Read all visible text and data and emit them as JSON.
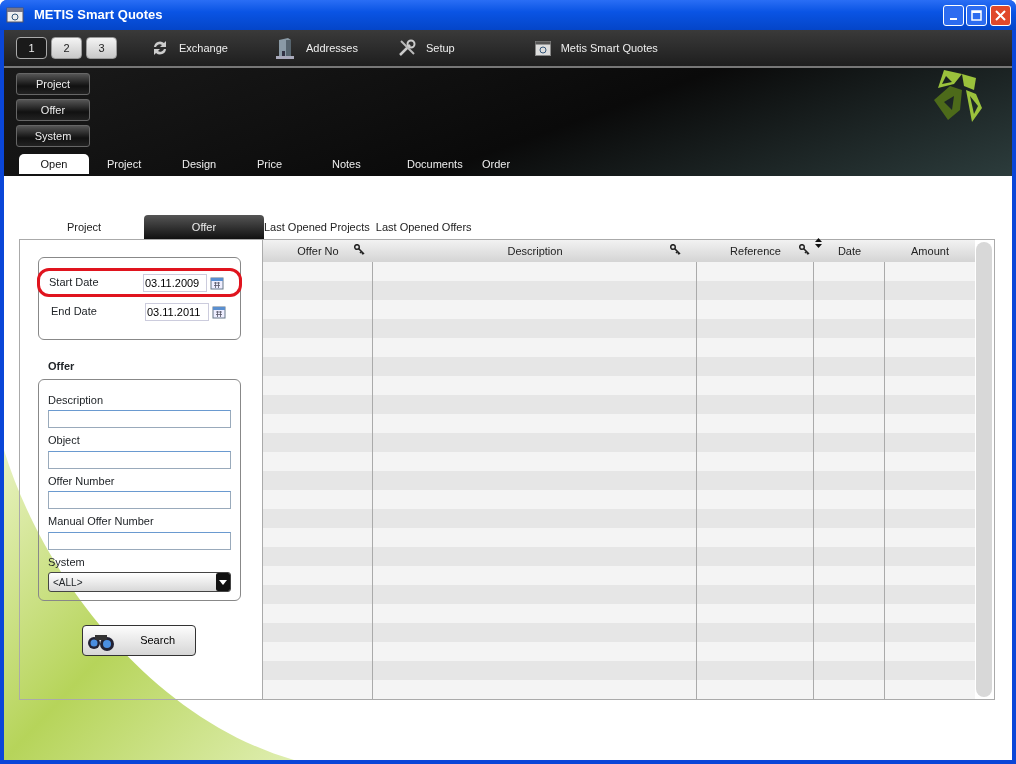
{
  "window": {
    "title": "METIS Smart Quotes"
  },
  "toolbar": {
    "pages": [
      {
        "label": "1",
        "selected": true
      },
      {
        "label": "2",
        "selected": false
      },
      {
        "label": "3",
        "selected": false
      }
    ],
    "items": [
      {
        "label": "Exchange",
        "kind": "exchange"
      },
      {
        "label": "Addresses",
        "kind": "addresses"
      },
      {
        "label": "Setup",
        "kind": "setup"
      },
      {
        "label": "Metis Smart Quotes",
        "kind": "app"
      }
    ]
  },
  "side_menu": [
    "Project",
    "Offer",
    "System"
  ],
  "tabs": [
    {
      "label": "Open",
      "selected": true
    },
    {
      "label": "Project",
      "selected": false
    },
    {
      "label": "Design",
      "selected": false
    },
    {
      "label": "Price",
      "selected": false
    },
    {
      "label": "Notes",
      "selected": false
    },
    {
      "label": "Documents",
      "selected": false
    },
    {
      "label": "Order",
      "selected": false
    }
  ],
  "subtabs": [
    {
      "label": "Project",
      "selected": false
    },
    {
      "label": "Offer",
      "selected": true
    },
    {
      "label": "Last Opened Projects",
      "selected": false
    },
    {
      "label": "Last Opened Offers",
      "selected": false
    }
  ],
  "date_filter": [
    {
      "label": "Start Date",
      "value": "03.11.2009",
      "highlighted": true
    },
    {
      "label": "End Date",
      "value": "03.11.2011",
      "highlighted": false
    }
  ],
  "offer_section": {
    "title": "Offer",
    "fields": [
      {
        "label": "Description",
        "kind": "text"
      },
      {
        "label": "Object",
        "kind": "text"
      },
      {
        "label": "Offer Number",
        "kind": "text"
      },
      {
        "label": "Manual Offer Number",
        "kind": "text"
      },
      {
        "label": "System",
        "kind": "select",
        "value": "<ALL>"
      }
    ]
  },
  "search_button": "Search",
  "table": {
    "columns": [
      {
        "label": "Offer No",
        "searchable": true,
        "sorted": false
      },
      {
        "label": "Description",
        "searchable": true,
        "sorted": false
      },
      {
        "label": "Reference",
        "searchable": true,
        "sorted": false
      },
      {
        "label": "Date",
        "searchable": false,
        "sorted": true
      },
      {
        "label": "Amount",
        "searchable": false,
        "sorted": false
      }
    ]
  }
}
